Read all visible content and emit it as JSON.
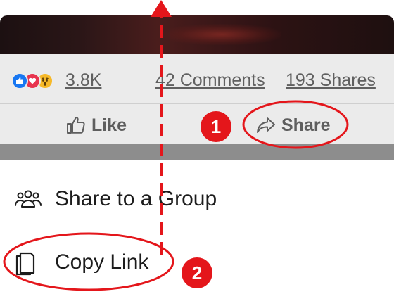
{
  "post": {
    "reaction_icons": [
      "thumbs-up-reaction-icon",
      "heart-reaction-icon",
      "wow-reaction-icon"
    ],
    "reaction_count": "3.8K",
    "comments_label": "42 Comments",
    "shares_label": "193 Shares"
  },
  "actions": {
    "like_label": "Like",
    "share_label": "Share"
  },
  "share_sheet": {
    "items": [
      {
        "label": "Share to a Group",
        "icon": "group-icon"
      },
      {
        "label": "Copy Link",
        "icon": "copy-icon"
      }
    ]
  },
  "annotations": {
    "step_1": "1",
    "step_2": "2",
    "color": "#e4161b"
  },
  "colors": {
    "facebook_blue": "#1877f2",
    "love_red": "#e8344e",
    "wow_yellow": "#f7b928",
    "annotation_red": "#e4161b"
  }
}
